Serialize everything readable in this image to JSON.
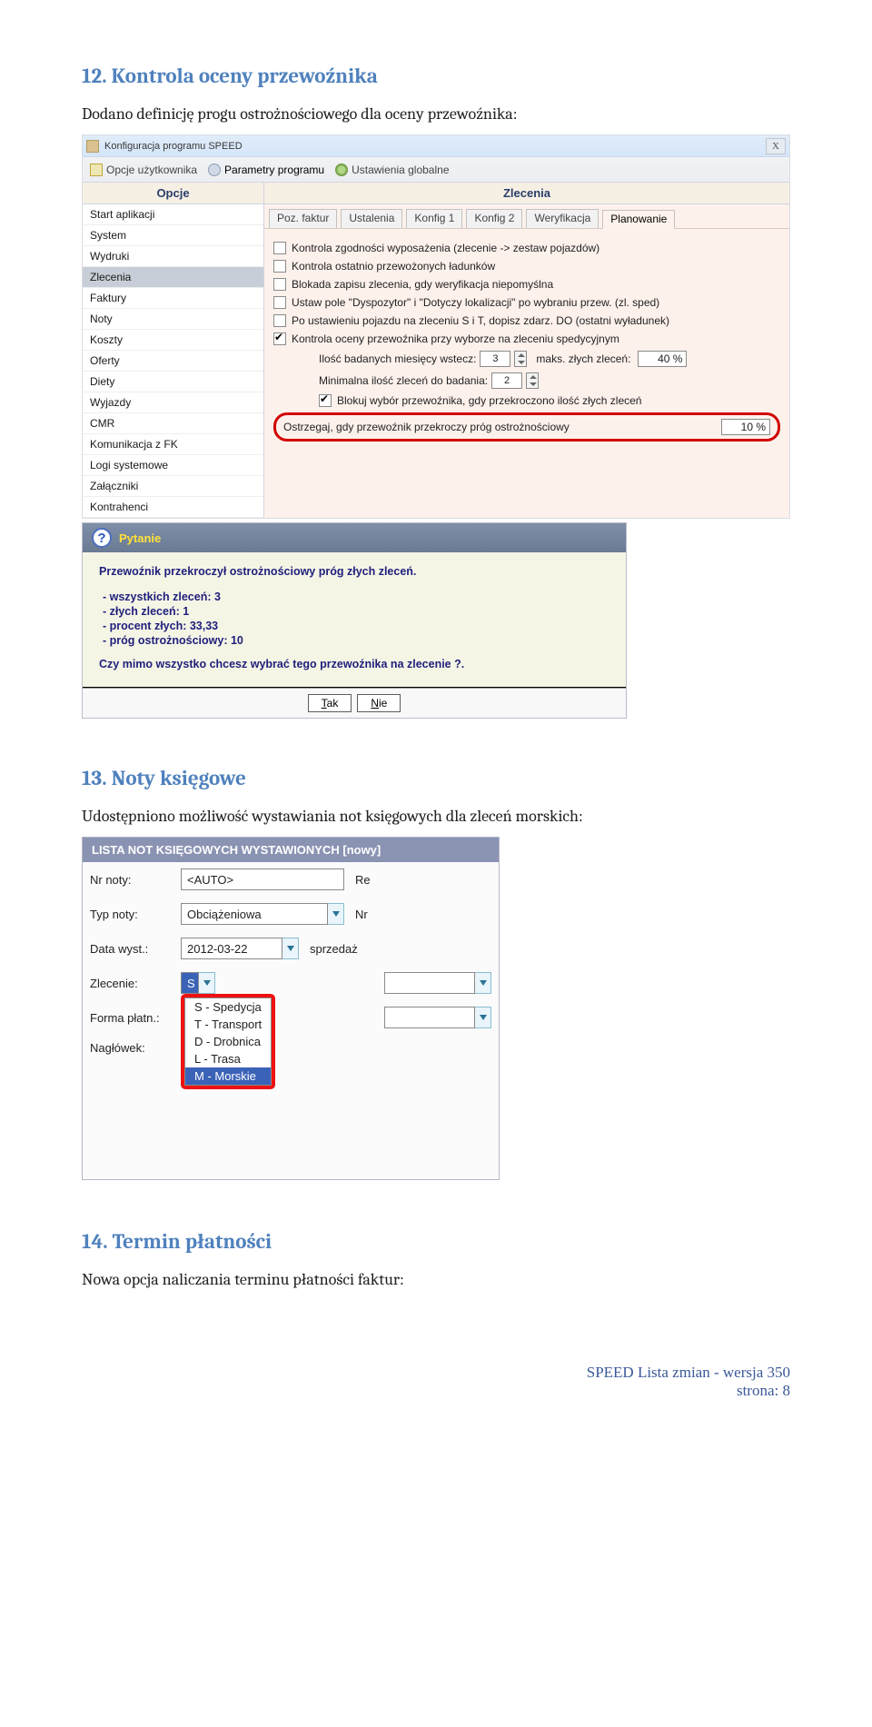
{
  "sec12": {
    "heading": "12. Kontrola oceny przewoźnika",
    "intro": "Dodano definicję progu ostrożnościowego dla oceny przewoźnika:"
  },
  "cfg": {
    "window_title": "Konfiguracja programu SPEED",
    "main_tabs": {
      "user": "Opcje użytkownika",
      "program": "Parametry programu",
      "global": "Ustawienia globalne"
    },
    "left_header": "Opcje",
    "right_header": "Zlecenia",
    "left_items": [
      "Start aplikacji",
      "System",
      "Wydruki",
      "Zlecenia",
      "Faktury",
      "Noty",
      "Koszty",
      "Oferty",
      "Diety",
      "Wyjazdy",
      "CMR",
      "Komunikacja z FK",
      "Logi systemowe",
      "Załączniki",
      "Kontrahenci"
    ],
    "left_selected_index": 3,
    "subtabs": [
      "Poz. faktur",
      "Ustalenia",
      "Konfig 1",
      "Konfig 2",
      "Weryfikacja",
      "Planowanie"
    ],
    "subtab_selected_index": 5,
    "chk": {
      "c1": "Kontrola zgodności wyposażenia (zlecenie -> zestaw pojazdów)",
      "c2": "Kontrola ostatnio przewożonych ładunków",
      "c3": "Blokada zapisu zlecenia, gdy weryfikacja niepomyślna",
      "c4": "Ustaw pole \"Dyspozytor\" i \"Dotyczy lokalizacji\" po wybraniu przew. (zl. sped)",
      "c5": "Po ustawieniu pojazdu na zleceniu S i T, dopisz zdarz. DO (ostatni wyładunek)",
      "c6": "Kontrola oceny przewoźnika przy wyborze na zleceniu spedycyjnym",
      "months_label": "Ilość badanych miesięcy wstecz:",
      "months_val": "3",
      "max_bad_label": "maks. złych zleceń:",
      "max_bad_val": "40 %",
      "min_orders_label": "Minimalna ilość zleceń do badania:",
      "min_orders_val": "2",
      "block_label": "Blokuj wybór przewoźnika, gdy przekroczono ilość złych zleceń",
      "warn_label": "Ostrzegaj, gdy przewoźnik przekroczy próg ostrożnościowy",
      "warn_val": "10 %"
    }
  },
  "dlg": {
    "title": "Pytanie",
    "head": "Przewoźnik przekroczył ostrożnościowy próg złych zleceń.",
    "l1": "- wszystkich zleceń: 3",
    "l2": "- złych zleceń: 1",
    "l3": "- procent złych: 33,33",
    "l4": "- próg ostrożnościowy: 10",
    "question": "Czy mimo wszystko chcesz wybrać tego przewoźnika na zlecenie ?.",
    "yes": "Tak",
    "no": "Nie"
  },
  "sec13": {
    "heading": "13. Noty księgowe",
    "intro": "Udostępniono możliwość wystawiania not księgowych dla zleceń morskich:"
  },
  "noty": {
    "header": "LISTA NOT KSIĘGOWYCH WYSTAWIONYCH  [nowy]",
    "nr_label": "Nr noty:",
    "nr_val": "<AUTO>",
    "nr_right": "Re",
    "typ_label": "Typ noty:",
    "typ_val": "Obciążeniowa",
    "typ_right": "Nr",
    "data_label": "Data wyst.:",
    "data_val": "2012-03-22",
    "data_right": "sprzedaż",
    "zlec_label": "Zlecenie:",
    "zlec_val": "S",
    "forma_label": "Forma płatn.:",
    "nagl_label": "Nagłówek:",
    "options": [
      "S - Spedycja",
      "T - Transport",
      "D - Drobnica",
      "L - Trasa",
      "M - Morskie"
    ],
    "selected_index": 4
  },
  "sec14": {
    "heading": "14. Termin płatności",
    "intro": "Nowa opcja naliczania terminu płatności faktur:"
  },
  "footer": {
    "l1": "SPEED Lista zmian - wersja 350",
    "l2": "strona: 8"
  }
}
